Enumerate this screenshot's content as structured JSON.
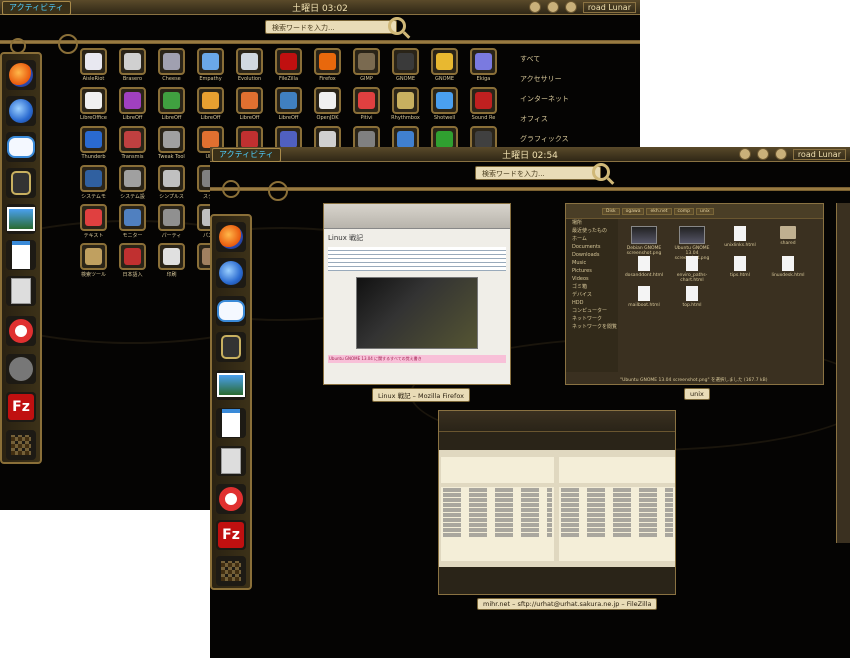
{
  "back_screen": {
    "activities": "アクティビティ",
    "clock": "土曜日 03:02",
    "user": "road Lunar",
    "search_placeholder": "検索ワードを入力...",
    "apps": [
      {
        "label": "AisleRiot",
        "color": "#e8e8f0"
      },
      {
        "label": "Brasero",
        "color": "#d0d0d0"
      },
      {
        "label": "Cheese",
        "color": "#a0a0b0"
      },
      {
        "label": "Empathy",
        "color": "#6aa8e8"
      },
      {
        "label": "Evolution",
        "color": "#d0d8e0"
      },
      {
        "label": "FileZilla",
        "color": "#c01010"
      },
      {
        "label": "Firefox",
        "color": "#e8680c"
      },
      {
        "label": "GIMP",
        "color": "#7a6a50"
      },
      {
        "label": "GNOME",
        "color": "#3a3a3a"
      },
      {
        "label": "GNOME",
        "color": "#e8b830"
      },
      {
        "label": "Ekiga",
        "color": "#7a7ae0"
      },
      {
        "label": "LibreOffice",
        "color": "#f0f0f0"
      },
      {
        "label": "LibreOff",
        "color": "#a040c0"
      },
      {
        "label": "LibreOff",
        "color": "#40a040"
      },
      {
        "label": "LibreOff",
        "color": "#e8a030"
      },
      {
        "label": "LibreOff",
        "color": "#e07030"
      },
      {
        "label": "LibreOff",
        "color": "#4080c0"
      },
      {
        "label": "OpenJDK",
        "color": "#f0f0f0"
      },
      {
        "label": "Pitivi",
        "color": "#e04040"
      },
      {
        "label": "Rhythmbox",
        "color": "#c8b060"
      },
      {
        "label": "Shotwell",
        "color": "#4aa0f0"
      },
      {
        "label": "Sound Re",
        "color": "#c02020"
      },
      {
        "label": "Thunderb",
        "color": "#2a6ad0"
      },
      {
        "label": "Transmis",
        "color": "#c04040"
      },
      {
        "label": "Tweak Tool",
        "color": "#a0a0a0"
      },
      {
        "label": "Ubu",
        "color": "#e07030"
      },
      {
        "label": "",
        "color": "#c03030"
      },
      {
        "label": "",
        "color": "#5060c0"
      },
      {
        "label": "",
        "color": "#d0d0d0"
      },
      {
        "label": "",
        "color": "#808080"
      },
      {
        "label": "",
        "color": "#4080d0"
      },
      {
        "label": "",
        "color": "#30a030"
      },
      {
        "label": "",
        "color": "#404040"
      },
      {
        "label": "システムモ",
        "color": "#3060a0"
      },
      {
        "label": "システム設",
        "color": "#a0a0a0"
      },
      {
        "label": "シンプルス",
        "color": "#c0c0c0"
      },
      {
        "label": "スクリ",
        "color": "#808080"
      },
      {
        "label": "テキスト",
        "color": "#e04040"
      },
      {
        "label": "モニター",
        "color": "#5080c0"
      },
      {
        "label": "パーティ",
        "color": "#909090"
      },
      {
        "label": "パスワ",
        "color": "#c0c0c0"
      },
      {
        "label": "検索ツール",
        "color": "#c0a060"
      },
      {
        "label": "日本語入",
        "color": "#c03030"
      },
      {
        "label": "印刷",
        "color": "#e0e0e0"
      },
      {
        "label": "",
        "color": "#a08060"
      }
    ],
    "categories": [
      "すべて",
      "アクセサリー",
      "インターネット",
      "オフィス",
      "グラフィックス"
    ]
  },
  "front_screen": {
    "activities": "アクティビティ",
    "clock": "土曜日 02:54",
    "user": "road Lunar",
    "search_placeholder": "検索ワードを入力...",
    "windows": [
      {
        "caption": "Linux 戦記 – Mozilla Firefox",
        "page_title": "Linux 戦記",
        "highlight": "Ubuntu GNOME 13.04 に関するすべての覚え書き"
      },
      {
        "caption": "unix",
        "status": "\"Ubuntu GNOME 13.04 screenshot.png\" を選択しました (167.7 kB)",
        "path": [
          "Disk",
          "ogawa",
          "ekh.net",
          "comp",
          "unix"
        ],
        "sidebar": [
          "場所",
          "最近使ったもの",
          "ホーム",
          "Documents",
          "Downloads",
          "Music",
          "Pictures",
          "Videos",
          "ゴミ箱",
          "デバイス",
          "HDD",
          "コンピューター",
          "ネットワーク",
          "ネットワークを閲覧"
        ],
        "files": [
          {
            "name": "Debian GNOME screenshot.png",
            "kind": "img"
          },
          {
            "name": "Ubuntu GNOME 13.04 screenshot.png",
            "kind": "img"
          },
          {
            "name": "unixlinks.html",
            "kind": "pg"
          },
          {
            "name": "shared",
            "kind": "fold"
          },
          {
            "name": "dosanddont.html",
            "kind": "pg"
          },
          {
            "name": "enviro_paths-chart.html",
            "kind": "pg"
          },
          {
            "name": "tips.html",
            "kind": "pg"
          },
          {
            "name": "linuxdesk.html",
            "kind": "pg"
          },
          {
            "name": "mailboot.html",
            "kind": "pg"
          },
          {
            "name": "top.html",
            "kind": "pg"
          }
        ]
      },
      {
        "caption": "mihr.net – sftp://urhat@urhat.sakura.ne.jp – FileZilla"
      }
    ]
  },
  "colors": {
    "accent": "#8a7242",
    "text": "#d8c89a",
    "bar": "#e9dcb7"
  }
}
